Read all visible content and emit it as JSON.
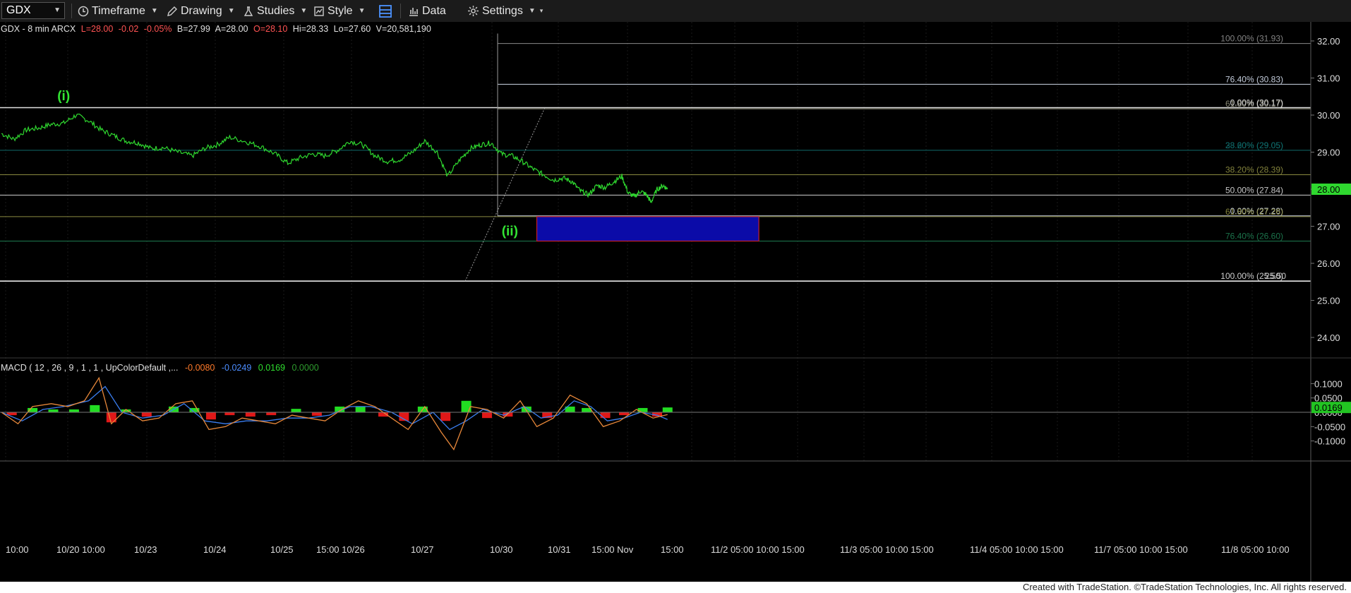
{
  "toolbar": {
    "symbol": "GDX",
    "timeframe": "Timeframe",
    "drawing": "Drawing",
    "studies": "Studies",
    "style": "Style",
    "data": "Data",
    "settings": "Settings"
  },
  "header": {
    "name": "GDX - 8 min  ARCX",
    "last": "L=28.00",
    "change": "-0.02",
    "pct": "-0.05%",
    "bid": "B=27.99",
    "ask": "A=28.00",
    "open": "O=28.10",
    "high": "Hi=28.33",
    "low": "Lo=27.60",
    "volume": "V=20,581,190"
  },
  "macd_header": {
    "label": "MACD ( 12 , 26 , 9 , 1 , 1 , UpColorDefault ,...",
    "v1": "-0.0080",
    "v2": "-0.0249",
    "v3": "0.0169",
    "v4": "0.0000"
  },
  "footer": "Created with TradeStation. ©TradeStation Technologies, Inc. All rights reserved.",
  "colors": {
    "price": "#2fd82f",
    "wave_label": "#33e533",
    "box_fill": "#0b0ba8",
    "box_border": "#c4202a",
    "macd_line": "#e8883a",
    "signal_line": "#3a7ef0",
    "hist_up": "#22dd22",
    "hist_down": "#e01818"
  },
  "chart_data": [
    {
      "type": "line",
      "title": "GDX - 8 min  ARCX",
      "ylim": [
        23.6,
        32.4
      ],
      "y_ticks": [
        "32.00",
        "31.00",
        "30.00",
        "29.00",
        "28.00",
        "27.00",
        "26.00",
        "25.00",
        "24.00"
      ],
      "x_ticks": [
        "10:00",
        "10/20 10:00",
        "10/23",
        "10/24",
        "10/25",
        "15:00 10/26",
        "10/27",
        "10/30",
        "10/31",
        "15:00 Nov",
        "15:00",
        "11/2  05:00 10:00 15:00",
        "11/3  05:00 10:00 15:00",
        "11/4  05:00 10:00 15:00",
        "11/7  05:00 10:00 15:00",
        "11/8  05:00 10:00"
      ],
      "last_price": "28.00",
      "series": [
        {
          "values": [
            [
              0,
              29.5
            ],
            [
              0.6,
              29.35
            ],
            [
              1.2,
              29.6
            ],
            [
              1.8,
              29.65
            ],
            [
              2.4,
              29.75
            ],
            [
              3.0,
              29.78
            ],
            [
              3.6,
              30.0
            ],
            [
              4.2,
              29.85
            ],
            [
              4.8,
              29.6
            ],
            [
              5.4,
              29.45
            ],
            [
              6.0,
              29.3
            ],
            [
              6.6,
              29.25
            ],
            [
              7.2,
              29.1
            ],
            [
              7.8,
              29.12
            ],
            [
              8.5,
              29.0
            ],
            [
              9.2,
              28.9
            ],
            [
              9.8,
              29.1
            ],
            [
              10.4,
              29.2
            ],
            [
              11.0,
              29.4
            ],
            [
              11.8,
              29.28
            ],
            [
              12.5,
              29.15
            ],
            [
              13.2,
              28.95
            ],
            [
              13.8,
              28.7
            ],
            [
              14.4,
              28.85
            ],
            [
              15.0,
              28.95
            ],
            [
              15.6,
              28.9
            ],
            [
              16.2,
              29.05
            ],
            [
              16.8,
              29.3
            ],
            [
              17.4,
              29.2
            ],
            [
              18.0,
              28.9
            ],
            [
              18.6,
              28.75
            ],
            [
              19.2,
              28.8
            ],
            [
              19.8,
              29.0
            ],
            [
              20.4,
              29.3
            ],
            [
              21.0,
              29.0
            ],
            [
              21.5,
              28.35
            ],
            [
              22.1,
              28.8
            ],
            [
              22.6,
              29.1
            ],
            [
              23.1,
              29.2
            ],
            [
              23.6,
              29.25
            ],
            [
              24.1,
              28.95
            ],
            [
              24.6,
              28.9
            ],
            [
              25.1,
              28.75
            ],
            [
              25.6,
              28.55
            ],
            [
              26.1,
              28.4
            ],
            [
              26.6,
              28.25
            ],
            [
              27.1,
              28.3
            ],
            [
              27.5,
              28.2
            ],
            [
              27.9,
              27.95
            ],
            [
              28.3,
              27.85
            ],
            [
              28.7,
              28.1
            ],
            [
              29.1,
              28.05
            ],
            [
              29.5,
              28.2
            ],
            [
              29.9,
              28.35
            ],
            [
              30.2,
              27.9
            ],
            [
              30.5,
              27.8
            ],
            [
              30.8,
              27.95
            ],
            [
              31.1,
              27.84
            ],
            [
              31.3,
              27.65
            ],
            [
              31.6,
              28.0
            ],
            [
              31.9,
              28.1
            ],
            [
              32.1,
              28.0
            ]
          ]
        }
      ],
      "annotations": [
        {
          "text": "(i)",
          "x": 3.0,
          "y": 30.4
        },
        {
          "text": "(ii)",
          "x": 24.5,
          "y": 26.75
        }
      ],
      "fib_levels": [
        {
          "label": "100.00% (31.93)",
          "value": 31.93
        },
        {
          "label": "76.40% (30.83)",
          "value": 30.83
        },
        {
          "label": "61.80% (30.17)",
          "value": 30.17
        },
        {
          "label": "0.00% (30.17)",
          "value": 30.2
        },
        {
          "label": "38.20% (29.05)",
          "value": 29.05
        },
        {
          "label": "23.60% (29.05)",
          "value": 29.05
        },
        {
          "label": "38.20% (28.39)",
          "value": 28.39
        },
        {
          "label": "50.00% (27.84)",
          "value": 27.84
        },
        {
          "label": "0.00% (27.28)",
          "value": 27.28
        },
        {
          "label": "61.80% (27.26)",
          "value": 27.26
        },
        {
          "label": "76.40% (26.60)",
          "value": 26.6
        },
        {
          "label": "100.00% (25.50)",
          "value": 25.52
        },
        {
          "label": "25.50",
          "value": 25.52
        }
      ],
      "target_box": {
        "x0": 25.8,
        "x1": 36.5,
        "y0": 26.6,
        "y1": 27.26
      }
    },
    {
      "type": "line",
      "title": "MACD ( 12 , 26 , 9 , 1 , 1 , UpColorDefault ,...",
      "ylim": [
        -0.16,
        0.17
      ],
      "y_ticks": [
        "0.1000",
        "0.0500",
        "0.0000",
        "-0.0500",
        "-0.1000"
      ],
      "last_value": "0.0169",
      "series": [
        {
          "name": "MACD",
          "values": [
            [
              0,
              0.0
            ],
            [
              0.8,
              -0.04
            ],
            [
              1.5,
              0.02
            ],
            [
              2.4,
              0.03
            ],
            [
              3.2,
              0.02
            ],
            [
              4.0,
              0.04
            ],
            [
              4.7,
              0.12
            ],
            [
              5.3,
              -0.04
            ],
            [
              6.0,
              0.01
            ],
            [
              6.8,
              -0.03
            ],
            [
              7.6,
              -0.02
            ],
            [
              8.4,
              0.03
            ],
            [
              9.2,
              0.04
            ],
            [
              10.0,
              -0.06
            ],
            [
              10.8,
              -0.05
            ],
            [
              11.6,
              -0.02
            ],
            [
              12.4,
              -0.03
            ],
            [
              13.2,
              -0.04
            ],
            [
              14.0,
              -0.01
            ],
            [
              14.8,
              -0.02
            ],
            [
              15.6,
              -0.03
            ],
            [
              16.4,
              0.01
            ],
            [
              17.2,
              0.04
            ],
            [
              18.0,
              0.02
            ],
            [
              18.8,
              -0.02
            ],
            [
              19.6,
              -0.06
            ],
            [
              20.4,
              0.02
            ],
            [
              21.2,
              -0.07
            ],
            [
              21.8,
              -0.13
            ],
            [
              22.6,
              0.02
            ],
            [
              23.4,
              0.01
            ],
            [
              24.2,
              -0.02
            ],
            [
              25.0,
              0.04
            ],
            [
              25.8,
              -0.05
            ],
            [
              26.6,
              -0.02
            ],
            [
              27.4,
              0.06
            ],
            [
              28.2,
              0.03
            ],
            [
              29.0,
              -0.05
            ],
            [
              29.8,
              -0.03
            ],
            [
              30.6,
              0.01
            ],
            [
              31.4,
              -0.02
            ],
            [
              32.1,
              -0.008
            ]
          ]
        },
        {
          "name": "Signal",
          "values": [
            [
              0,
              0.0
            ],
            [
              1.0,
              -0.03
            ],
            [
              2.0,
              0.01
            ],
            [
              3.0,
              0.02
            ],
            [
              4.2,
              0.04
            ],
            [
              5.0,
              0.09
            ],
            [
              5.8,
              0.0
            ],
            [
              6.8,
              -0.02
            ],
            [
              7.8,
              -0.01
            ],
            [
              8.8,
              0.03
            ],
            [
              9.8,
              -0.03
            ],
            [
              10.8,
              -0.04
            ],
            [
              11.8,
              -0.03
            ],
            [
              12.8,
              -0.03
            ],
            [
              13.8,
              -0.02
            ],
            [
              14.8,
              -0.02
            ],
            [
              15.8,
              -0.01
            ],
            [
              16.8,
              0.02
            ],
            [
              17.8,
              0.02
            ],
            [
              18.8,
              0.0
            ],
            [
              19.8,
              -0.04
            ],
            [
              20.8,
              0.0
            ],
            [
              21.6,
              -0.06
            ],
            [
              22.4,
              -0.03
            ],
            [
              23.2,
              0.01
            ],
            [
              24.2,
              -0.01
            ],
            [
              25.2,
              0.02
            ],
            [
              26.0,
              -0.02
            ],
            [
              26.8,
              -0.01
            ],
            [
              27.6,
              0.04
            ],
            [
              28.4,
              0.02
            ],
            [
              29.2,
              -0.03
            ],
            [
              30.0,
              -0.02
            ],
            [
              30.8,
              0.0
            ],
            [
              31.6,
              -0.01
            ],
            [
              32.1,
              -0.025
            ]
          ]
        },
        {
          "name": "Histogram",
          "values": [
            [
              0.5,
              -0.01
            ],
            [
              1.5,
              0.015
            ],
            [
              2.5,
              0.01
            ],
            [
              3.5,
              0.01
            ],
            [
              4.5,
              0.025
            ],
            [
              5.3,
              -0.035
            ],
            [
              6.0,
              0.01
            ],
            [
              7.0,
              -0.015
            ],
            [
              8.3,
              0.02
            ],
            [
              9.3,
              0.015
            ],
            [
              10.1,
              -0.025
            ],
            [
              11.0,
              -0.01
            ],
            [
              12.0,
              -0.015
            ],
            [
              13.0,
              -0.01
            ],
            [
              14.2,
              0.012
            ],
            [
              15.2,
              -0.012
            ],
            [
              16.3,
              0.02
            ],
            [
              17.3,
              0.02
            ],
            [
              18.4,
              -0.015
            ],
            [
              19.4,
              -0.03
            ],
            [
              20.3,
              0.02
            ],
            [
              21.4,
              -0.03
            ],
            [
              22.4,
              0.04
            ],
            [
              23.4,
              -0.02
            ],
            [
              24.4,
              -0.015
            ],
            [
              25.3,
              0.02
            ],
            [
              26.3,
              -0.02
            ],
            [
              27.4,
              0.02
            ],
            [
              28.2,
              0.015
            ],
            [
              29.1,
              -0.02
            ],
            [
              30.0,
              -0.01
            ],
            [
              30.9,
              0.015
            ],
            [
              31.6,
              -0.015
            ],
            [
              32.1,
              0.0169
            ]
          ]
        }
      ]
    }
  ]
}
